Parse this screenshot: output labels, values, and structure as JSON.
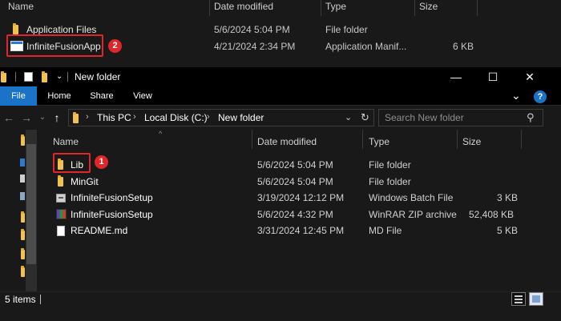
{
  "background_window": {
    "columns": {
      "name": "Name",
      "date": "Date modified",
      "type": "Type",
      "size": "Size"
    },
    "rows": [
      {
        "name": "Application Files",
        "date": "5/6/2024 5:04 PM",
        "type": "File folder",
        "size": "",
        "icon": "folder-icon"
      },
      {
        "name": "InfiniteFusionApp",
        "date": "4/21/2024 2:34 PM",
        "type": "Application Manif...",
        "size": "6 KB",
        "icon": "application-icon"
      }
    ],
    "callout_number": "2"
  },
  "explorer": {
    "title": "New folder",
    "window_controls": {
      "minimize": "—",
      "maximize": "☐",
      "close": "✕"
    },
    "ribbon_tabs": {
      "file": "File",
      "home": "Home",
      "share": "Share",
      "view": "View"
    },
    "ribbon_expand": "⌄",
    "help": "?",
    "nav": {
      "back": "←",
      "forward": "→",
      "recent": "⌄",
      "up": "↑"
    },
    "breadcrumbs": [
      "This PC",
      "Local Disk (C:)",
      "New folder"
    ],
    "address_dropdown": "⌄",
    "refresh": "↻",
    "search": {
      "placeholder": "Search New folder",
      "icon": "⚲"
    },
    "columns": {
      "name": "Name",
      "date": "Date modified",
      "type": "Type",
      "size": "Size"
    },
    "sort_indicator": "^",
    "rows": [
      {
        "name": "Lib",
        "date": "5/6/2024 5:04 PM",
        "type": "File folder",
        "size": "",
        "icon": "folder-icon"
      },
      {
        "name": "MinGit",
        "date": "5/6/2024 5:04 PM",
        "type": "File folder",
        "size": "",
        "icon": "folder-icon"
      },
      {
        "name": "InfiniteFusionSetup",
        "date": "3/19/2024 12:12 PM",
        "type": "Windows Batch File",
        "size": "3 KB",
        "icon": "batch-file-icon"
      },
      {
        "name": "InfiniteFusionSetup",
        "date": "5/6/2024 4:32 PM",
        "type": "WinRAR ZIP archive",
        "size": "52,408 KB",
        "icon": "zip-archive-icon"
      },
      {
        "name": "README.md",
        "date": "3/31/2024 12:45 PM",
        "type": "MD File",
        "size": "5 KB",
        "icon": "document-icon"
      }
    ],
    "callout_number": "1",
    "status": {
      "items": "5 items"
    }
  },
  "colors": {
    "background": "#191919",
    "titlebar": "#000000",
    "accent": "#1a73c7",
    "callout": "#e0262a",
    "folder": "#f2c14e"
  }
}
